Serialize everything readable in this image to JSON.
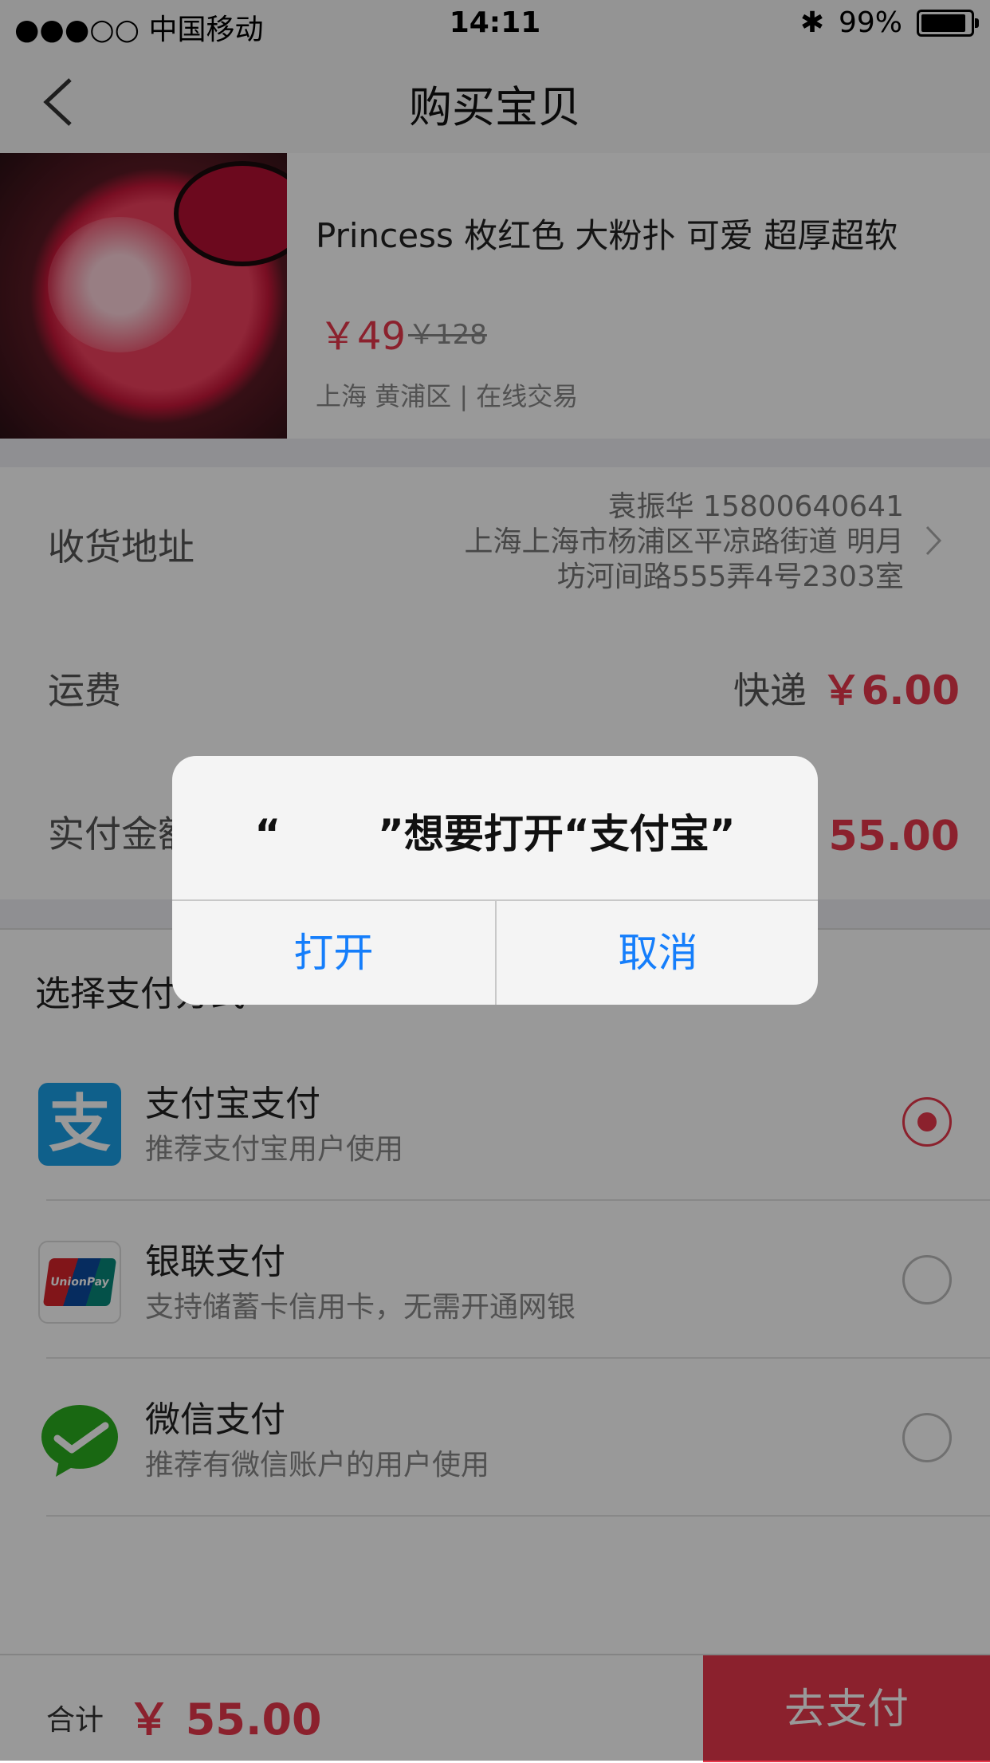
{
  "status_bar": {
    "carrier": "●●●○○ 中国移动",
    "time": "14:11",
    "battery": "99%"
  },
  "nav": {
    "title": "购买宝贝"
  },
  "product": {
    "name": "Princess 枚红色 大粉扑 可爱 超厚超软",
    "price": "￥49",
    "original_price": "￥128",
    "location": "上海 黄浦区 | 在线交易"
  },
  "address": {
    "label": "收货地址",
    "line1": "袁振华 15800640641",
    "line2": "上海上海市杨浦区平凉路街道 明月",
    "line3": "坊河间路555弄4号2303室"
  },
  "shipping": {
    "label": "运费",
    "type": "快递",
    "price": "￥6.00"
  },
  "total_row": {
    "label": "实付金额",
    "price": "￥ 55.00"
  },
  "payment": {
    "header": "选择支付方式",
    "methods": [
      {
        "name": "支付宝支付",
        "desc": "推荐支付宝用户使用",
        "icon": "alipay-icon",
        "selected": true
      },
      {
        "name": "银联支付",
        "desc": "支持储蓄卡信用卡，无需开通网银",
        "icon": "unionpay-icon",
        "selected": false
      },
      {
        "name": "微信支付",
        "desc": "推荐有微信账户的用户使用",
        "icon": "wechat-icon",
        "selected": false
      }
    ]
  },
  "bottom_bar": {
    "sum_label": "合计",
    "sum": "￥ 55.00",
    "pay_button": "去支付"
  },
  "dialog": {
    "message": "“       ”想要打开“支付宝”",
    "open_button": "打开",
    "cancel_button": "取消"
  },
  "colors": {
    "accent": "#e8374b",
    "ios_blue": "#157efb",
    "alipay_blue": "#1aa0e8",
    "wechat_green": "#2bad1e"
  }
}
